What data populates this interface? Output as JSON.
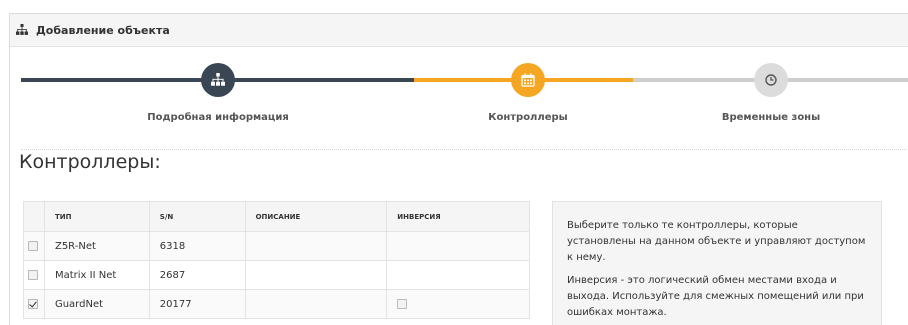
{
  "panel": {
    "title": "Добавление объекта",
    "icon": "sitemap-icon"
  },
  "wizard": {
    "current_step": 2,
    "colors": {
      "done": "#3a4653",
      "active": "#f5a623",
      "pending": "#cfcfcf"
    },
    "steps": [
      {
        "label": "Подробная информация",
        "icon": "sitemap-icon",
        "state": "done"
      },
      {
        "label": "Контроллеры",
        "icon": "calendar-icon",
        "state": "active"
      },
      {
        "label": "Временные зоны",
        "icon": "clock-icon",
        "state": "pending"
      }
    ]
  },
  "section": {
    "title": "Контроллеры:"
  },
  "table": {
    "columns": [
      "ТИП",
      "S/N",
      "ОПИСАНИЕ",
      "ИНВЕРСИЯ"
    ],
    "rows": [
      {
        "selected": false,
        "type": "Z5R-Net",
        "sn": "6318",
        "description": "",
        "inversion_visible": false,
        "inversion": false
      },
      {
        "selected": false,
        "type": "Matrix II Net",
        "sn": "2687",
        "description": "",
        "inversion_visible": false,
        "inversion": false
      },
      {
        "selected": true,
        "type": "GuardNet",
        "sn": "20177",
        "description": "",
        "inversion_visible": true,
        "inversion": false
      }
    ]
  },
  "info": {
    "p1": "Выберите только те контроллеры, которые установлены на данном объекте и управляют доступом к нему.",
    "p2": "Инверсия - это логический обмен местами входа и выхода. Используйте для смежных помещений или при ошибках монтажа."
  }
}
